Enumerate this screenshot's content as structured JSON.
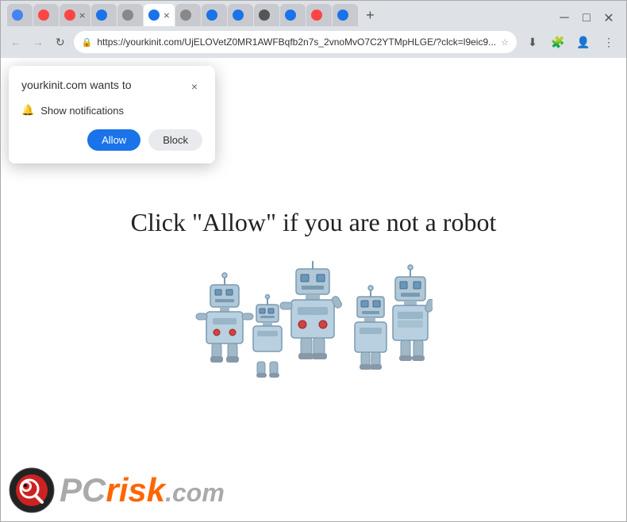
{
  "browser": {
    "tabs": [
      {
        "label": "",
        "favicon_color": "#4285f4",
        "active": false
      },
      {
        "label": "",
        "favicon_color": "#ff4444",
        "active": false
      },
      {
        "label": "",
        "favicon_color": "#ff4444",
        "active": false
      },
      {
        "label": "",
        "favicon_color": "#1a73e8",
        "active": false
      },
      {
        "label": "",
        "favicon_color": "#888",
        "active": false
      },
      {
        "label": "",
        "favicon_color": "#1a73e8",
        "active": true
      },
      {
        "label": "",
        "favicon_color": "#888",
        "active": false
      },
      {
        "label": "",
        "favicon_color": "#1a73e8",
        "active": false
      },
      {
        "label": "",
        "favicon_color": "#1a73e8",
        "active": false
      },
      {
        "label": "",
        "favicon_color": "#555",
        "active": false
      },
      {
        "label": "",
        "favicon_color": "#1a73e8",
        "active": false
      },
      {
        "label": "",
        "favicon_color": "#ff4444",
        "active": false
      },
      {
        "label": "",
        "favicon_color": "#1a73e8",
        "active": false
      }
    ],
    "address": "https://yourkinit.com/UjELOVetZ0MR1AWFBqfb2n7s_2vnoMvO7C2YTMpHLGE/?clck=l9eic9...",
    "new_tab_label": "+",
    "back_btn": "←",
    "forward_btn": "→",
    "reload_btn": "↻"
  },
  "popup": {
    "title": "yourkinit.com wants to",
    "close_label": "×",
    "notification_icon": "🔔",
    "notification_text": "Show notifications",
    "allow_label": "Allow",
    "block_label": "Block"
  },
  "page": {
    "heading": "Click \"Allow\"  if you are not   a robot"
  },
  "pcrisk": {
    "pc_text": "PC",
    "risk_text": "risk",
    "com_text": ".com"
  },
  "icons": {
    "lock": "🔒",
    "star": "☆",
    "download": "⬇",
    "profile": "👤",
    "menu": "⋮",
    "extensions": "🧩"
  }
}
